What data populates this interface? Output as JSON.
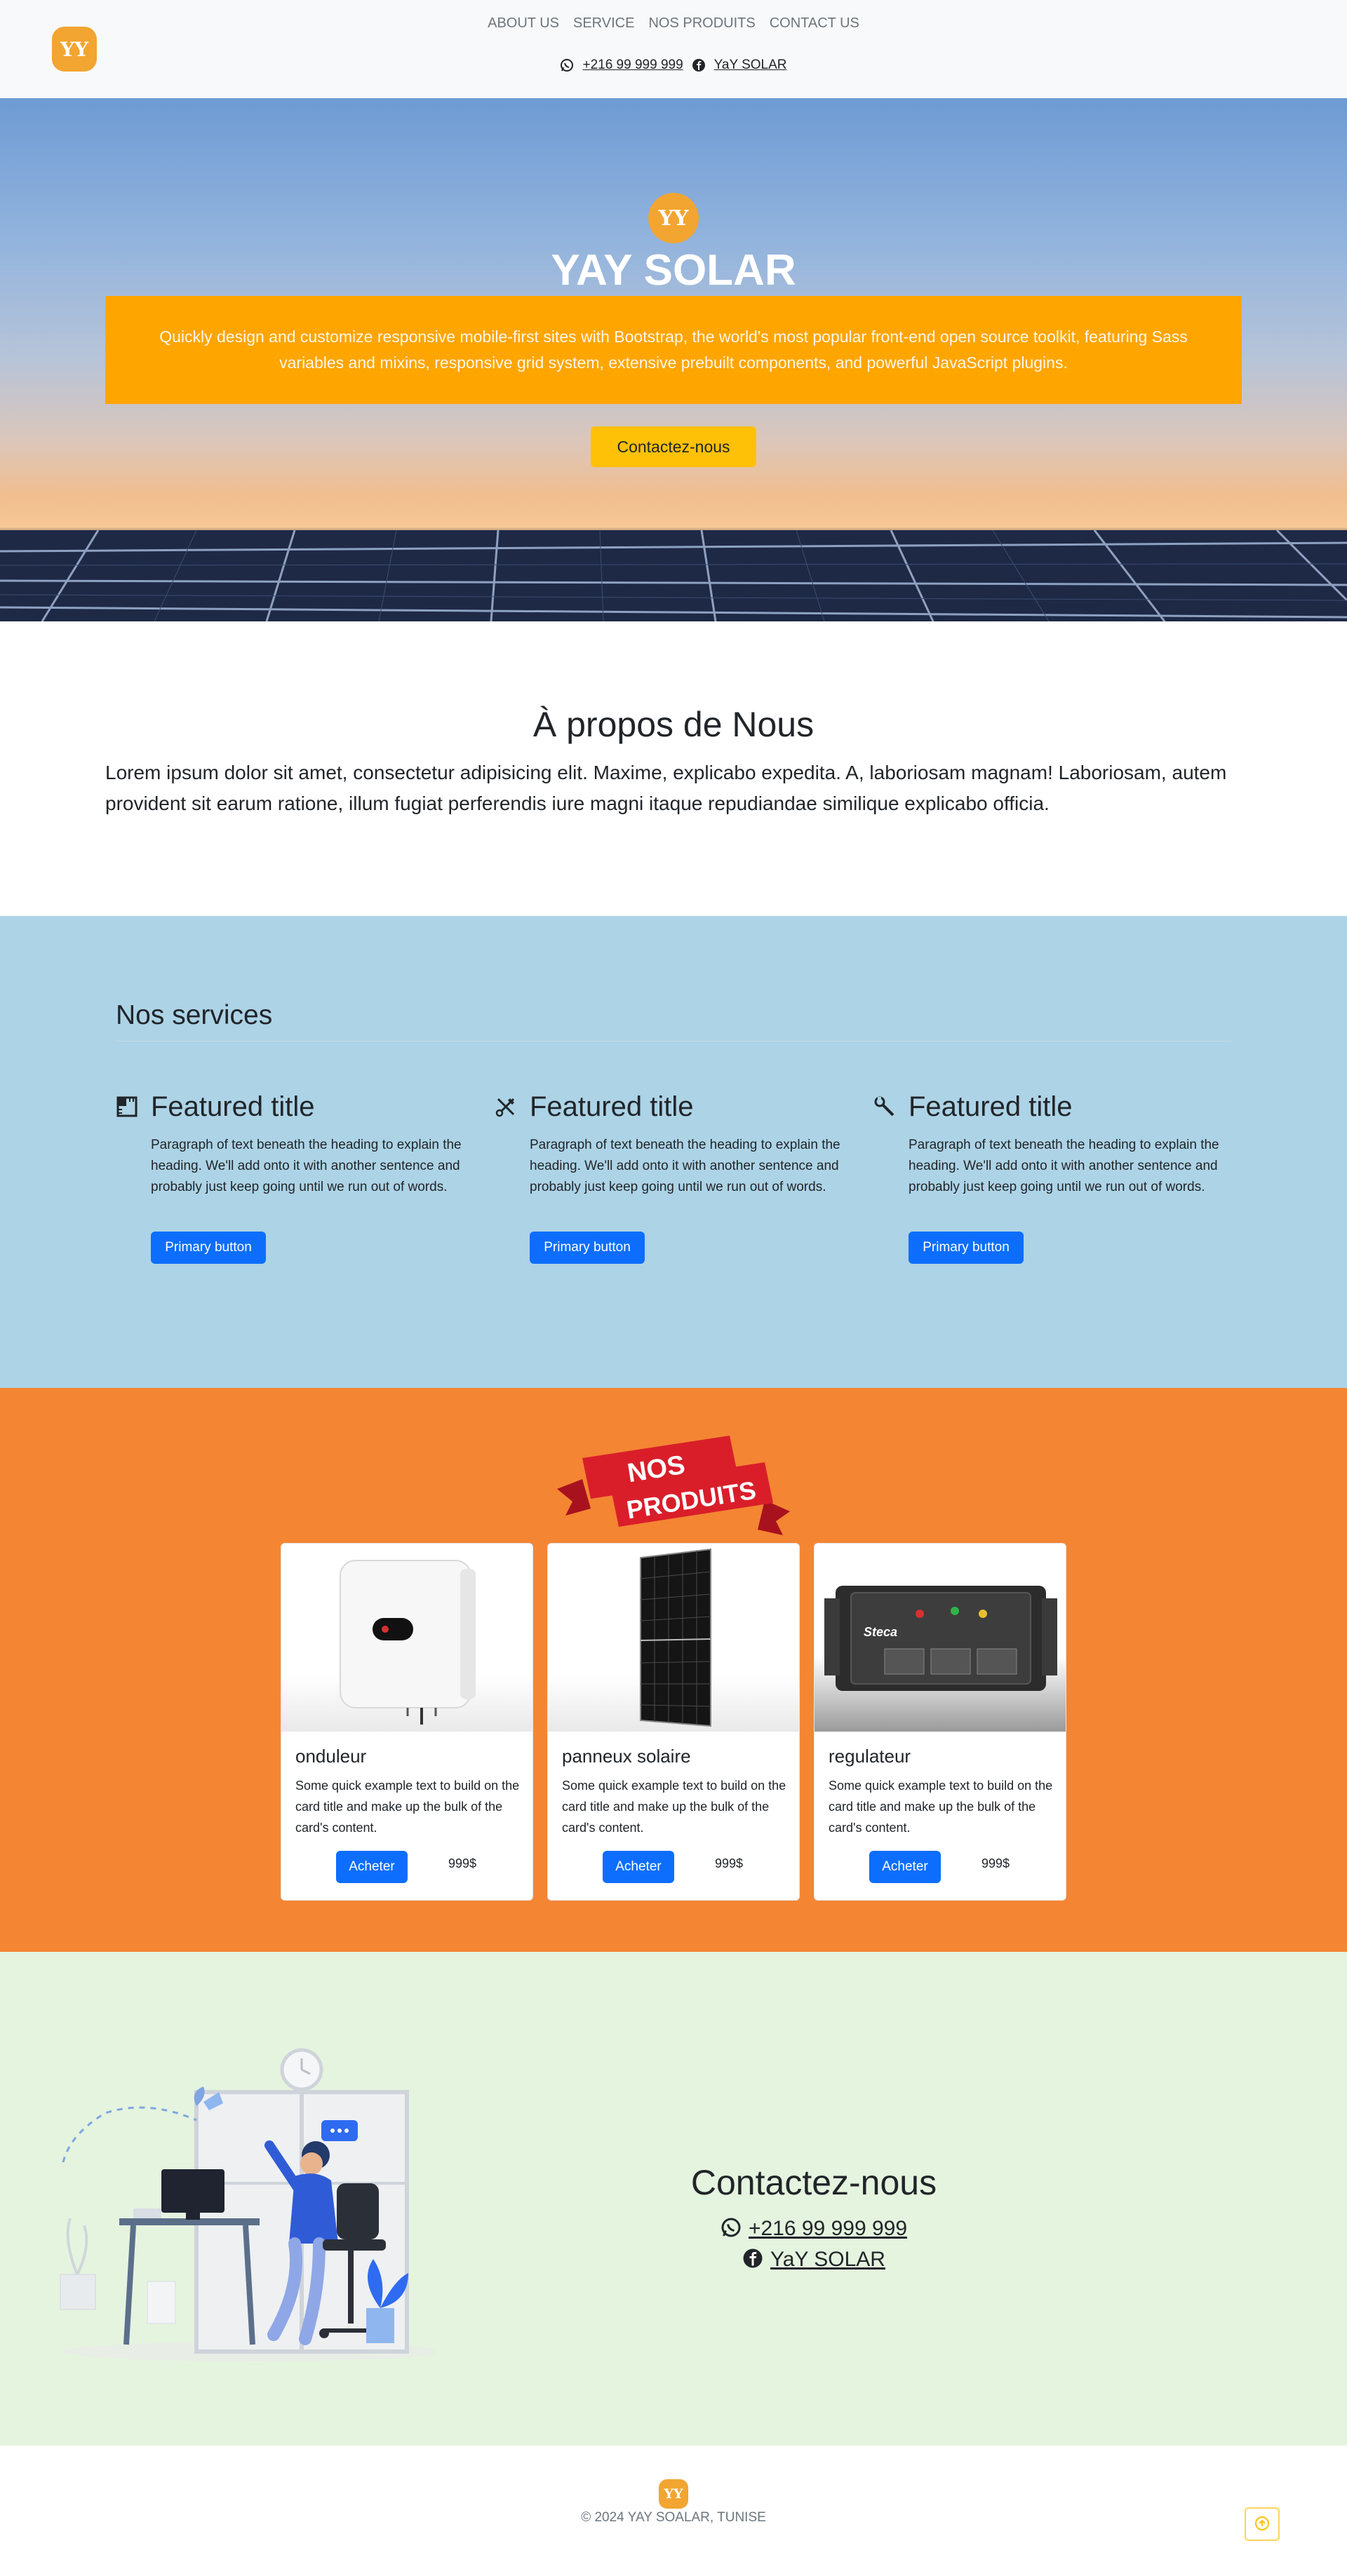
{
  "nav": {
    "logo_text": "YY",
    "links": [
      "ABOUT US",
      "SERVICE",
      "NOS PRODUITS",
      "CONTACT US"
    ],
    "phone": "+216 99 999 999",
    "facebook": "YaY SOLAR"
  },
  "hero": {
    "logo_text": "YY",
    "title": "YAY SOLAR",
    "lead": "Quickly design and customize responsive mobile-first sites with Bootstrap, the world's most popular front-end open source toolkit, featuring Sass variables and mixins, responsive grid system, extensive prebuilt components, and powerful JavaScript plugins.",
    "cta": "Contactez-nous"
  },
  "about": {
    "title": "À propos de Nous",
    "text": "Lorem ipsum dolor sit amet, consectetur adipisicing elit. Maxime, explicabo expedita. A, laboriosam magnam! Laboriosam, autem provident sit earum ratione, illum fugiat perferendis iure magni itaque repudiandae similique explicabo officia."
  },
  "services": {
    "title": "Nos services",
    "items": [
      {
        "icon": "ruler-icon",
        "title": "Featured title",
        "text": "Paragraph of text beneath the heading to explain the heading. We'll add onto it with another sentence and probably just keep going until we run out of words.",
        "button": "Primary button"
      },
      {
        "icon": "tools-icon",
        "title": "Featured title",
        "text": "Paragraph of text beneath the heading to explain the heading. We'll add onto it with another sentence and probably just keep going until we run out of words.",
        "button": "Primary button"
      },
      {
        "icon": "wrench-icon",
        "title": "Featured title",
        "text": "Paragraph of text beneath the heading to explain the heading. We'll add onto it with another sentence and probably just keep going until we run out of words.",
        "button": "Primary button"
      }
    ]
  },
  "products": {
    "ribbon_line1": "NOS",
    "ribbon_line2": "PRODUITS",
    "items": [
      {
        "title": "onduleur",
        "text": "Some quick example text to build on the card title and make up the bulk of the card's content.",
        "button": "Acheter",
        "price": "999$"
      },
      {
        "title": "panneux solaire",
        "text": "Some quick example text to build on the card title and make up the bulk of the card's content.",
        "button": "Acheter",
        "price": "999$"
      },
      {
        "title": "regulateur",
        "text": "Some quick example text to build on the card title and make up the bulk of the card's content.",
        "button": "Acheter",
        "price": "999$"
      }
    ],
    "regulator_brand": "Steca"
  },
  "contact": {
    "title": "Contactez-nous",
    "phone": "+216 99 999 999",
    "facebook": "YaY SOLAR"
  },
  "footer": {
    "logo_text": "YY",
    "copyright": "© 2024 YAY SOALAR, TUNISE"
  },
  "colors": {
    "accent_orange": "#ffa500",
    "cta_yellow": "#ffc107",
    "primary_blue": "#0d6efd",
    "services_bg": "#add3e6",
    "products_bg": "#f48533",
    "contact_bg": "#e5f4df"
  }
}
